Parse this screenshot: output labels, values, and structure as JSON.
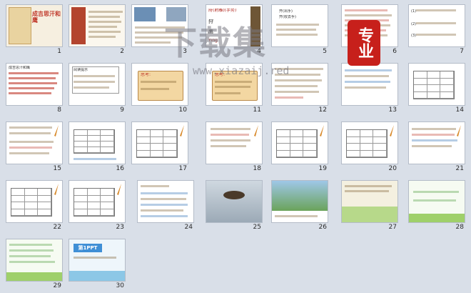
{
  "slides": [
    {
      "n": "1",
      "lines": [
        "成吉思汗和鹰"
      ]
    },
    {
      "n": "2",
      "lines": []
    },
    {
      "n": "3",
      "lines": []
    },
    {
      "n": "4",
      "lines": [
        "府(射雕)(手势)",
        "狩",
        "鹰",
        "Yīng"
      ]
    },
    {
      "n": "5",
      "lines": [
        "开(出手)",
        "开(收去手)"
      ]
    },
    {
      "n": "6",
      "lines": []
    },
    {
      "n": "7",
      "lines": [
        "(1)",
        "(2)",
        "(3)"
      ]
    },
    {
      "n": "8",
      "lines": [
        "成吉思汗和鹰"
      ]
    },
    {
      "n": "9",
      "lines": [
        "阅读提示"
      ]
    },
    {
      "n": "10",
      "lines": [
        "思考:"
      ]
    },
    {
      "n": "11",
      "lines": [
        "思考:"
      ]
    },
    {
      "n": "12",
      "lines": []
    },
    {
      "n": "13",
      "lines": []
    },
    {
      "n": "14",
      "lines": []
    },
    {
      "n": "15",
      "lines": []
    },
    {
      "n": "16",
      "lines": []
    },
    {
      "n": "17",
      "lines": []
    },
    {
      "n": "18",
      "lines": []
    },
    {
      "n": "19",
      "lines": []
    },
    {
      "n": "20",
      "lines": []
    },
    {
      "n": "21",
      "lines": []
    },
    {
      "n": "22",
      "lines": []
    },
    {
      "n": "23",
      "lines": []
    },
    {
      "n": "24",
      "lines": []
    },
    {
      "n": "25",
      "lines": []
    },
    {
      "n": "26",
      "lines": []
    },
    {
      "n": "27",
      "lines": []
    },
    {
      "n": "28",
      "lines": []
    },
    {
      "n": "29",
      "lines": []
    },
    {
      "n": "30",
      "lines": [
        "第1PPT"
      ]
    }
  ],
  "watermark": {
    "text": "下载集",
    "url": "www.xiazaij.red",
    "badge": "专业"
  }
}
